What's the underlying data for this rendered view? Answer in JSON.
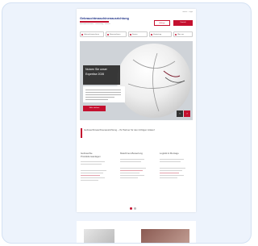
{
  "site": {
    "logo": "Gebrauchtmaschinenausrichtung",
    "logo_sub": "Industriemaschinen · Vermietung · Service",
    "top_links": "Kontakt · Login",
    "header_button_outline": "Anfrage",
    "header_button_red": "Kontakt"
  },
  "nav": {
    "items": [
      {
        "label": "Gebrauchtmaschinen"
      },
      {
        "label": "Neumaschinen"
      },
      {
        "label": "Service"
      },
      {
        "label": "Vermietung"
      },
      {
        "label": "Über uns"
      }
    ]
  },
  "hero": {
    "headline_1": "Nutzen Sie unser",
    "headline_2": "Expertise 2026",
    "body_lines": [
      "",
      "",
      "",
      "",
      ""
    ],
    "cta": "Mehr erfahren",
    "prev": "‹",
    "next": "›"
  },
  "intro": {
    "text": "Gebrauchtmaschinenausrichtung – Ihr Partner für den richtigen Ankauf"
  },
  "columns": [
    {
      "title": "Gebrauchte Produktionsanlagen"
    },
    {
      "title": "Maschinen-Bewertung"
    },
    {
      "title": "Logistik & Montage"
    }
  ],
  "colors": {
    "accent": "#c4102f",
    "brand": "#283a8c",
    "frame": "#edf3fc"
  }
}
